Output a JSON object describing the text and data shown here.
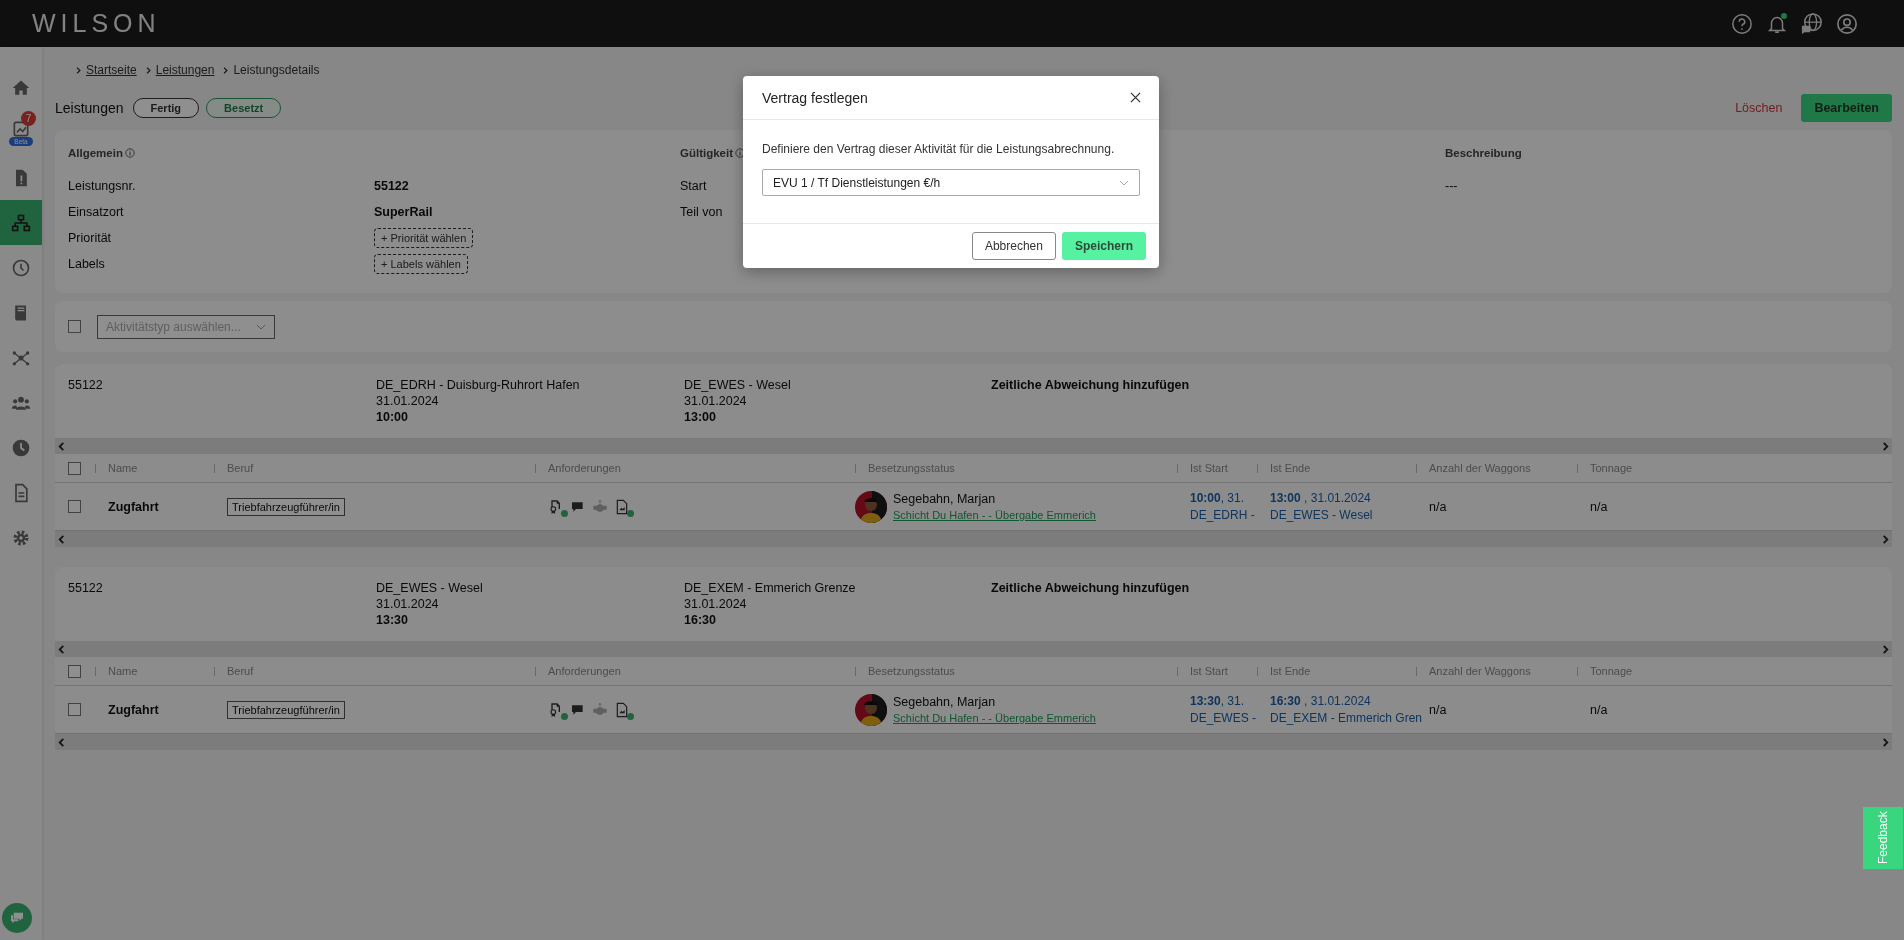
{
  "header": {
    "logo": "WILSON",
    "icons": [
      {
        "kind": "help",
        "dot": false
      },
      {
        "kind": "bell",
        "dot": true
      },
      {
        "kind": "globe",
        "dot": false
      },
      {
        "kind": "user",
        "dot": false
      }
    ]
  },
  "sidebar": {
    "items": [
      {
        "kind": "home",
        "selected": false
      },
      {
        "kind": "chart",
        "selected": false,
        "badge": "7",
        "tag": "Beta"
      },
      {
        "kind": "docalert",
        "selected": false
      },
      {
        "kind": "sitemap",
        "selected": true
      },
      {
        "kind": "clock",
        "selected": false
      },
      {
        "kind": "book",
        "selected": false
      },
      {
        "kind": "nodes",
        "selected": false
      },
      {
        "kind": "people",
        "selected": false
      },
      {
        "kind": "clockfill",
        "selected": false
      },
      {
        "kind": "document",
        "selected": false
      },
      {
        "kind": "gear",
        "selected": false
      }
    ]
  },
  "breadcrumb": [
    {
      "label": "Startseite",
      "link": true
    },
    {
      "label": "Leistungen",
      "link": true
    },
    {
      "label": "Leistungsdetails",
      "link": false
    }
  ],
  "page": {
    "title": "Leistungen",
    "chips": [
      {
        "label": "Fertig",
        "selected": false
      },
      {
        "label": "Besetzt",
        "selected": true
      }
    ],
    "delete_label": "Löschen",
    "edit_label": "Bearbeiten"
  },
  "details": {
    "sections": [
      {
        "title": "Allgemein",
        "info": true,
        "fields": [
          {
            "label": "Leistungsnr.",
            "value": "55122",
            "kind": "text"
          },
          {
            "label": "Einsatzort",
            "value": "SuperRail",
            "kind": "text"
          },
          {
            "label": "Priorität",
            "value": "+ Priorität wählen",
            "kind": "picker"
          },
          {
            "label": "Labels",
            "value": "+ Labels wählen",
            "kind": "picker"
          }
        ]
      },
      {
        "title": "Gültigkeit",
        "info": true,
        "fields": [
          {
            "label": "Start",
            "kind": "label"
          },
          {
            "label": "Teil von",
            "kind": "label"
          }
        ]
      },
      {
        "title": "Beschreibung",
        "info": false,
        "fields": [
          {
            "value": "---",
            "kind": "plain"
          }
        ]
      }
    ]
  },
  "activity_filter": {
    "checked": false,
    "placeholder": "Aktivitätstyp auswählen..."
  },
  "legs": [
    {
      "number": "55122",
      "from": {
        "station": "DE_EDRH - Duisburg-Ruhrort Hafen",
        "date": "31.01.2024",
        "time": "10:00"
      },
      "to": {
        "station": "DE_EWES - Wesel",
        "date": "31.01.2024",
        "time": "13:00"
      },
      "action": "Zeitliche Abweichung hinzufügen",
      "columns": [
        "Name",
        "Beruf",
        "Anforderungen",
        "Besetzungsstatus",
        "Ist Start",
        "Ist Ende",
        "Anzahl der Waggons",
        "Tonnage"
      ],
      "header_checked": false,
      "rows": [
        {
          "checked": false,
          "name": "Zugfahrt",
          "role": "Triebfahrzeugführer/in",
          "requirements": [
            {
              "kind": "certificate",
              "ok": true,
              "disabled": false
            },
            {
              "kind": "chat",
              "ok": false,
              "disabled": false
            },
            {
              "kind": "handshake",
              "ok": false,
              "disabled": true
            },
            {
              "kind": "file",
              "ok": true,
              "disabled": false
            }
          ],
          "person": "Segebahn, Marjan",
          "shift": "Schicht Du Hafen - - Übergabe Emmerich",
          "start_time": "10:00",
          "start_date": ", 31.",
          "start_station": "DE_EDRH -",
          "end_time": "13:00",
          "end_date": " , 31.01.2024",
          "end_station": "DE_EWES - Wesel",
          "waggons": "n/a",
          "tonnage": "n/a"
        }
      ]
    },
    {
      "number": "55122",
      "from": {
        "station": "DE_EWES - Wesel",
        "date": "31.01.2024",
        "time": "13:30"
      },
      "to": {
        "station": "DE_EXEM - Emmerich Grenze",
        "date": "31.01.2024",
        "time": "16:30"
      },
      "action": "Zeitliche Abweichung hinzufügen",
      "columns": [
        "Name",
        "Beruf",
        "Anforderungen",
        "Besetzungsstatus",
        "Ist Start",
        "Ist Ende",
        "Anzahl der Waggons",
        "Tonnage"
      ],
      "header_checked": false,
      "rows": [
        {
          "checked": false,
          "name": "Zugfahrt",
          "role": "Triebfahrzeugführer/in",
          "requirements": [
            {
              "kind": "certificate",
              "ok": true,
              "disabled": false
            },
            {
              "kind": "chat",
              "ok": false,
              "disabled": false
            },
            {
              "kind": "handshake",
              "ok": false,
              "disabled": true
            },
            {
              "kind": "file",
              "ok": true,
              "disabled": false
            }
          ],
          "person": "Segebahn, Marjan",
          "shift": "Schicht Du Hafen - - Übergabe Emmerich",
          "start_time": "13:30",
          "start_date": ", 31.",
          "start_station": "DE_EWES -",
          "end_time": "16:30",
          "end_date": " , 31.01.2024",
          "end_station": "DE_EXEM - Emmerich Gren",
          "waggons": "n/a",
          "tonnage": "n/a"
        }
      ]
    }
  ],
  "modal": {
    "title": "Vertrag festlegen",
    "text": "Definiere den Vertrag dieser Aktivität für die Leistungsabrechnung.",
    "select_value": "EVU 1 / Tf Dienstleistungen €/h",
    "cancel_label": "Abbrechen",
    "save_label": "Speichern"
  },
  "feedback_label": "Feedback"
}
